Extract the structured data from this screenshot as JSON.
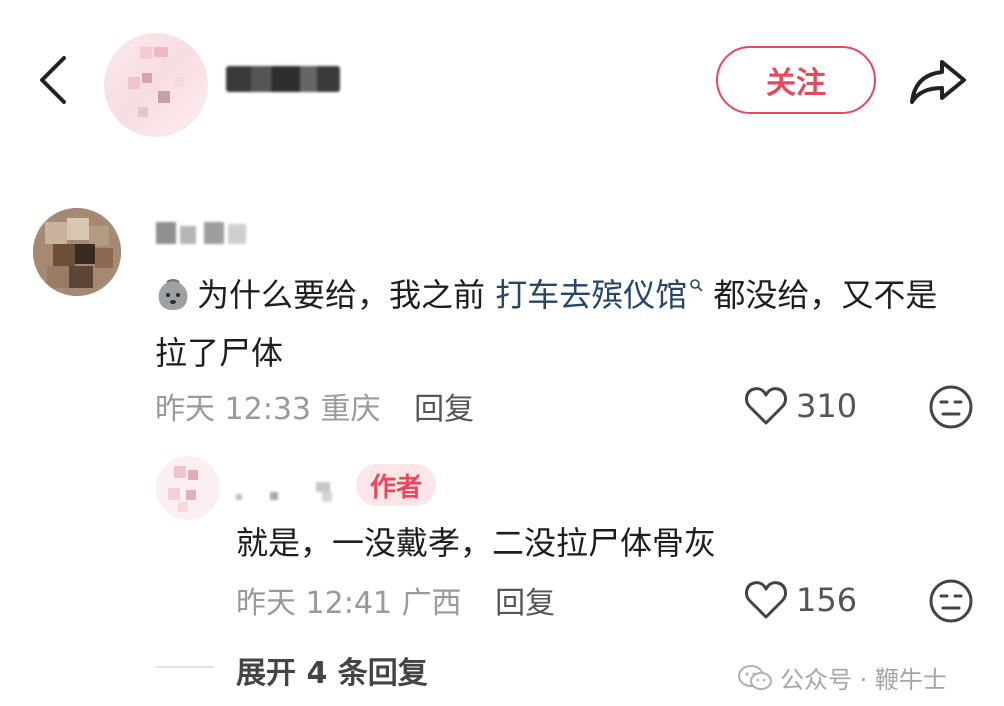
{
  "header": {
    "follow_label": "关注"
  },
  "comments": [
    {
      "text_before": "为什么要给，我之前 ",
      "topic": "打车去殡仪馆",
      "text_after": " 都没给，又不是拉了尸体",
      "time": "昨天 12:33",
      "location": "重庆",
      "reply_label": "回复",
      "likes": "310"
    },
    {
      "badge": "作者",
      "text": "就是，一没戴孝，二没拉尸体骨灰",
      "time": "昨天 12:41",
      "location": "广西",
      "reply_label": "回复",
      "likes": "156"
    }
  ],
  "expand_label": "展开 4 条回复",
  "watermark": "公众号 · 鞭牛士",
  "colors": {
    "accent": "#e8485a",
    "topic_link": "#27446a",
    "meta_text": "#9a9a9a"
  }
}
